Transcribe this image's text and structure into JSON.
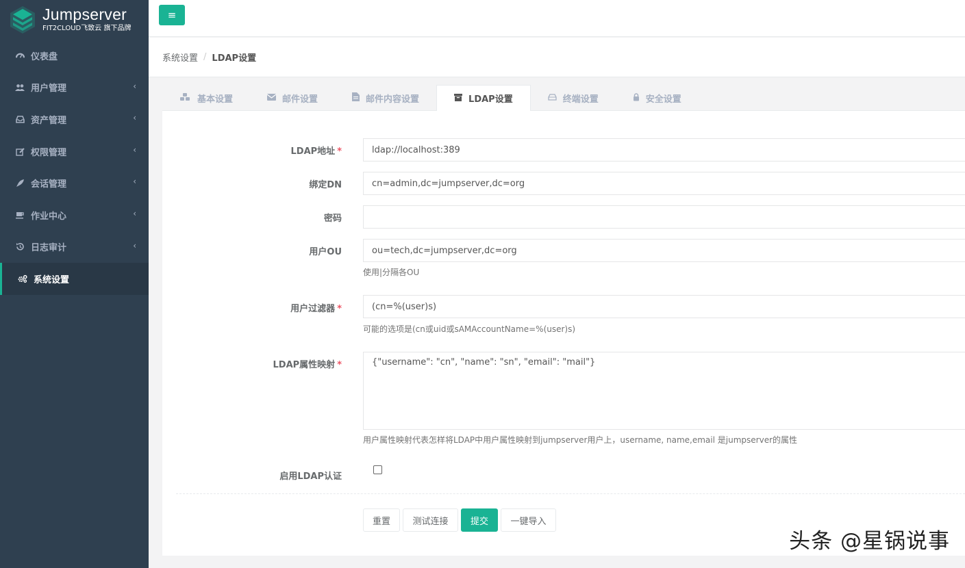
{
  "brand": {
    "title": "Jumpserver",
    "subtitle": "FIT2CLOUD飞致云 旗下品牌",
    "color": "#1ab394"
  },
  "sidebar": {
    "items": [
      {
        "label": "仪表盘",
        "icon": "dashboard-icon"
      },
      {
        "label": "用户管理",
        "icon": "users-icon"
      },
      {
        "label": "资产管理",
        "icon": "inbox-icon"
      },
      {
        "label": "权限管理",
        "icon": "edit-icon"
      },
      {
        "label": "会话管理",
        "icon": "rocket-icon"
      },
      {
        "label": "作业中心",
        "icon": "coffee-icon"
      },
      {
        "label": "日志审计",
        "icon": "history-icon"
      },
      {
        "label": "系统设置",
        "icon": "gears-icon",
        "active": true
      }
    ],
    "chevron": "‹"
  },
  "topbar": {
    "menu_icon": "≡"
  },
  "breadcrumb": {
    "parent": "系统设置",
    "separator": "/",
    "current": "LDAP设置"
  },
  "tabs": [
    {
      "label": "基本设置",
      "icon": "cubes-icon"
    },
    {
      "label": "邮件设置",
      "icon": "envelope-icon"
    },
    {
      "label": "邮件内容设置",
      "icon": "file-text-icon"
    },
    {
      "label": "LDAP设置",
      "icon": "archive-icon",
      "active": true
    },
    {
      "label": "终端设置",
      "icon": "hdd-icon"
    },
    {
      "label": "安全设置",
      "icon": "lock-icon"
    }
  ],
  "form": {
    "ldap_url": {
      "label": "LDAP地址",
      "required": "*",
      "value": "ldap://localhost:389"
    },
    "bind_dn": {
      "label": "绑定DN",
      "value": "cn=admin,dc=jumpserver,dc=org"
    },
    "password": {
      "label": "密码",
      "value": ""
    },
    "user_ou": {
      "label": "用户OU",
      "value": "ou=tech,dc=jumpserver,dc=org",
      "help": "使用|分隔各OU"
    },
    "user_filter": {
      "label": "用户过滤器",
      "required": "*",
      "value": "(cn=%(user)s)",
      "help": "可能的选项是(cn或uid或sAMAccountName=%(user)s)"
    },
    "attr_map": {
      "label": "LDAP属性映射",
      "required": "*",
      "value": "{\"username\": \"cn\", \"name\": \"sn\", \"email\": \"mail\"}",
      "help": "用户属性映射代表怎样将LDAP中用户属性映射到jumpserver用户上，username, name,email 是jumpserver的属性"
    },
    "enable_auth": {
      "label": "启用LDAP认证",
      "checked": false
    }
  },
  "buttons": {
    "reset": "重置",
    "test": "测试连接",
    "submit": "提交",
    "import": "一键导入"
  },
  "watermark": "头条 @星锅说事"
}
